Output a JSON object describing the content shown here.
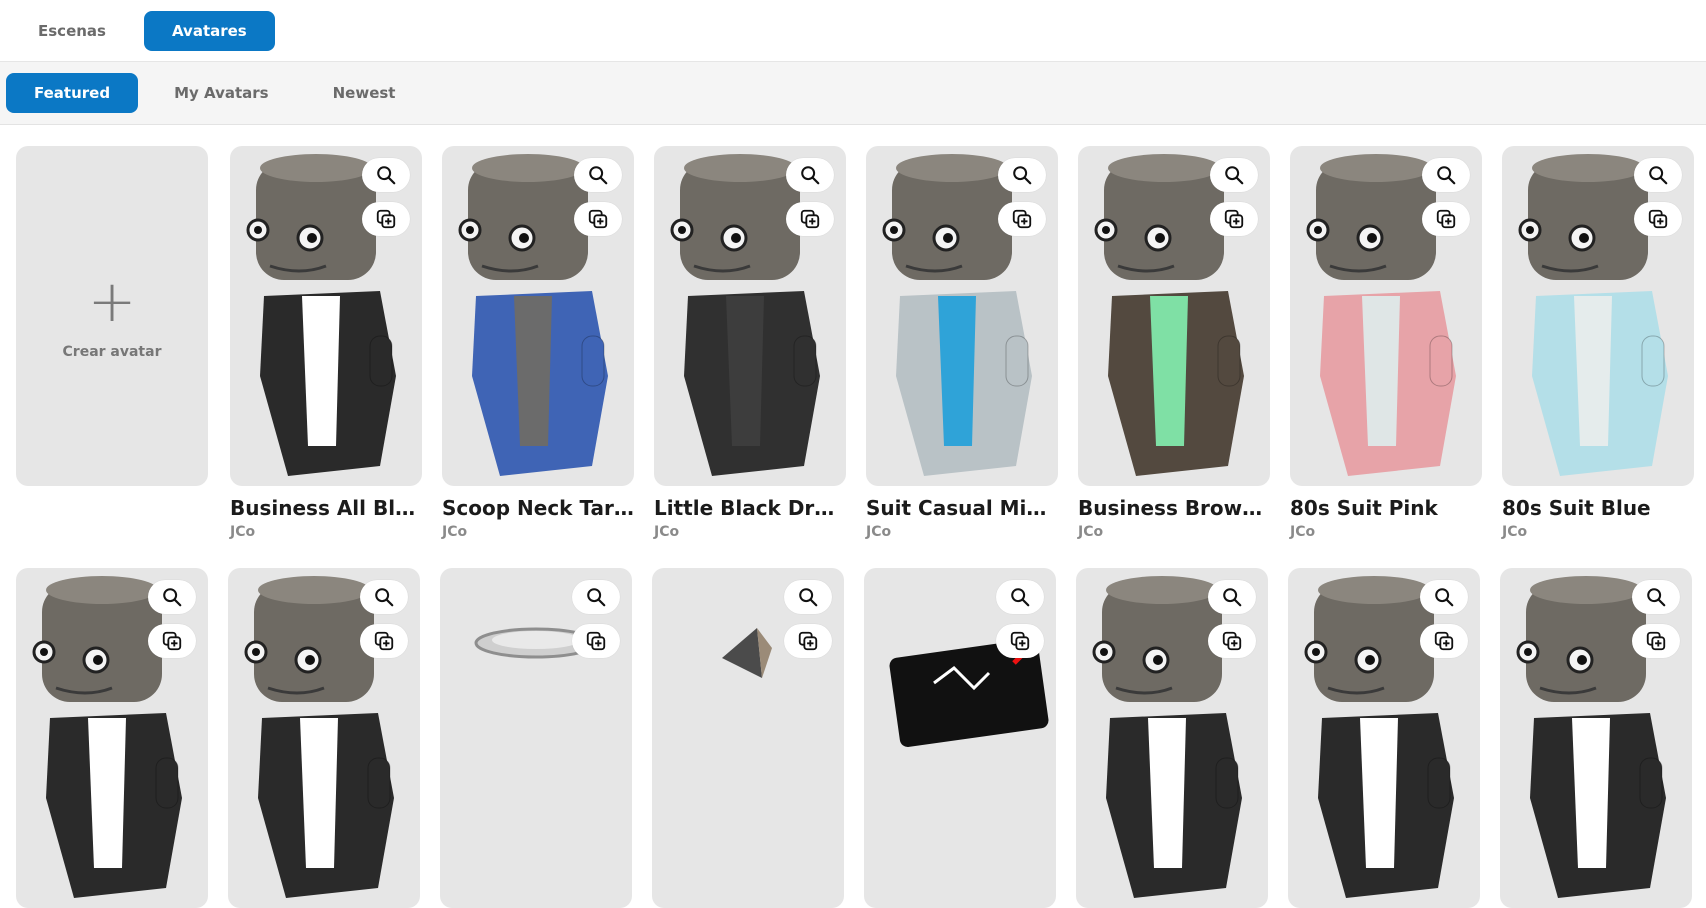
{
  "top_tabs": {
    "scenes": "Escenas",
    "avatars": "Avatares"
  },
  "sub_tabs": {
    "featured": "Featured",
    "my_avatars": "My Avatars",
    "newest": "Newest"
  },
  "create": {
    "label": "Crear avatar",
    "icon": "plus-icon"
  },
  "icons": {
    "preview": "magnifier-icon",
    "add": "duplicate-plus-icon"
  },
  "colors": {
    "accent": "#0b78c5",
    "card_bg": "#e6e6e6"
  },
  "avatars_row1": [
    {
      "title": "Business All Black",
      "author": "JCo",
      "outfit": "#2a2a2a",
      "accent": "#ffffff"
    },
    {
      "title": "Scoop Neck Tart...",
      "author": "JCo",
      "outfit": "#3f64b5",
      "accent": "#6b6b6b"
    },
    {
      "title": "Little Black Dress",
      "author": "JCo",
      "outfit": "#303030",
      "accent": "#3d3d3d"
    },
    {
      "title": "Suit Casual Miami",
      "author": "JCo",
      "outfit": "#b9c2c6",
      "accent": "#2fa3d8"
    },
    {
      "title": "Business Brown/...",
      "author": "JCo",
      "outfit": "#53493f",
      "accent": "#7fe0a5"
    },
    {
      "title": "80s Suit Pink",
      "author": "JCo",
      "outfit": "#e7a3a8",
      "accent": "#dfe6e6"
    },
    {
      "title": "80s Suit Blue",
      "author": "JCo",
      "outfit": "#b4dfe8",
      "accent": "#e5ecec"
    }
  ]
}
